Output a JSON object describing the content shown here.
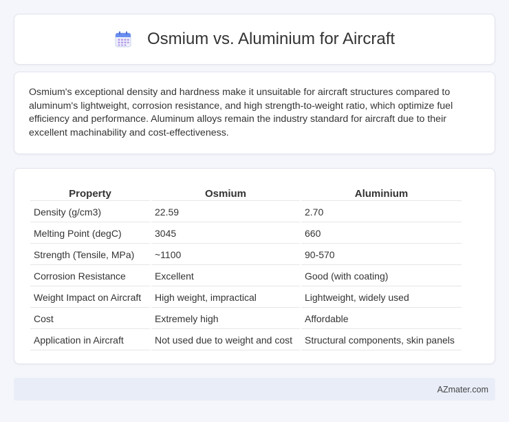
{
  "header": {
    "title": "Osmium vs. Aluminium for Aircraft",
    "icon": "calendar-icon",
    "icon_color": "#6a8ef0"
  },
  "summary": {
    "text": "Osmium's exceptional density and hardness make it unsuitable for aircraft structures compared to aluminum's lightweight, corrosion resistance, and high strength-to-weight ratio, which optimize fuel efficiency and performance. Aluminum alloys remain the industry standard for aircraft due to their excellent machinability and cost-effectiveness."
  },
  "table": {
    "headers": [
      "Property",
      "Osmium",
      "Aluminium"
    ],
    "rows": [
      [
        "Density (g/cm3)",
        "22.59",
        "2.70"
      ],
      [
        "Melting Point (degC)",
        "3045",
        "660"
      ],
      [
        "Strength (Tensile, MPa)",
        "~1100",
        "90-570"
      ],
      [
        "Corrosion Resistance",
        "Excellent",
        "Good (with coating)"
      ],
      [
        "Weight Impact on Aircraft",
        "High weight, impractical",
        "Lightweight, widely used"
      ],
      [
        "Cost",
        "Extremely high",
        "Affordable"
      ],
      [
        "Application in Aircraft",
        "Not used due to weight and cost",
        "Structural components, skin panels"
      ]
    ]
  },
  "footer": {
    "brand": "AZmater.com"
  }
}
